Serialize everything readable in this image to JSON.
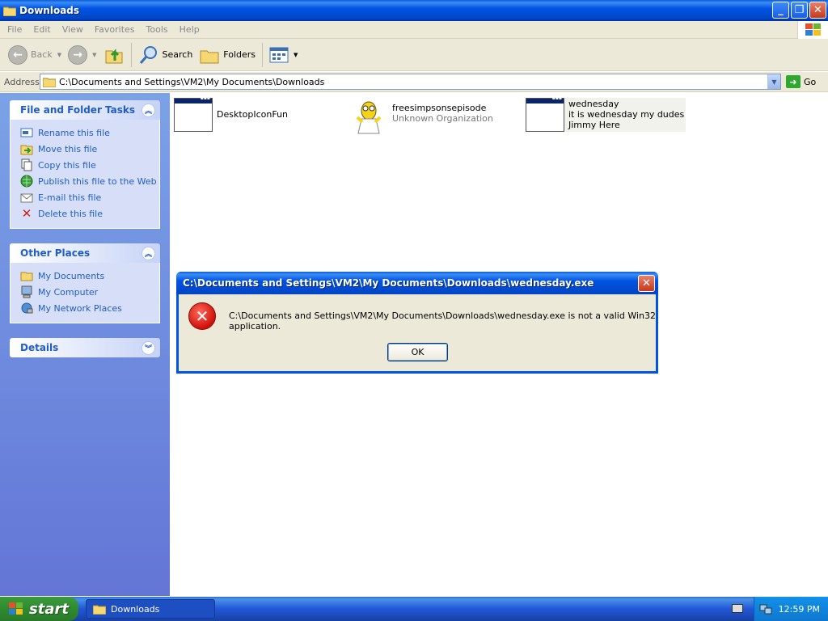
{
  "window": {
    "title": "Downloads"
  },
  "menu": [
    "File",
    "Edit",
    "View",
    "Favorites",
    "Tools",
    "Help"
  ],
  "toolbar": {
    "back_label": "Back",
    "search_label": "Search",
    "folders_label": "Folders"
  },
  "address": {
    "label": "Address",
    "value": "C:\\Documents and Settings\\VM2\\My Documents\\Downloads",
    "go_label": "Go"
  },
  "file_tasks": {
    "title": "File and Folder Tasks",
    "items": [
      {
        "label": "Rename this file",
        "icon": "rename-icon"
      },
      {
        "label": "Move this file",
        "icon": "move-icon"
      },
      {
        "label": "Copy this file",
        "icon": "copy-icon"
      },
      {
        "label": "Publish this file to the Web",
        "icon": "globe-icon"
      },
      {
        "label": "E-mail this file",
        "icon": "email-icon"
      },
      {
        "label": "Delete this file",
        "icon": "delete-icon"
      }
    ]
  },
  "other_places": {
    "title": "Other Places",
    "items": [
      {
        "label": "My Documents",
        "icon": "folder-icon"
      },
      {
        "label": "My Computer",
        "icon": "computer-icon"
      },
      {
        "label": "My Network Places",
        "icon": "network-icon"
      }
    ]
  },
  "details": {
    "title": "Details"
  },
  "files": [
    {
      "name": "DesktopIconFun",
      "icon": "exe-window-icon"
    },
    {
      "name": "freesimpsonsepisode",
      "sub": "Unknown Organization",
      "icon": "homer-icon"
    },
    {
      "name": "wednesday",
      "sub1": "it is wednesday my dudes",
      "sub2": "Jimmy Here",
      "icon": "exe-window-icon"
    }
  ],
  "dialog": {
    "title": "C:\\Documents and Settings\\VM2\\My Documents\\Downloads\\wednesday.exe",
    "message": "C:\\Documents and Settings\\VM2\\My Documents\\Downloads\\wednesday.exe is not a valid Win32 application.",
    "ok_label": "OK"
  },
  "taskbar": {
    "start_label": "start",
    "active_window": "Downloads",
    "clock": "12:59 PM"
  }
}
